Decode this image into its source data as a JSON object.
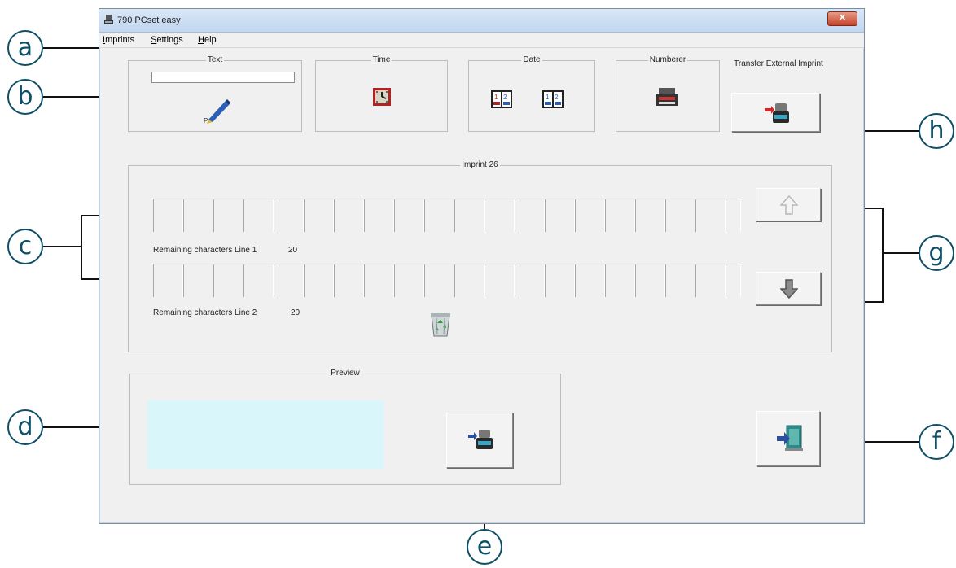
{
  "window": {
    "title": "790 PCset easy",
    "close_label": "✕"
  },
  "menu": [
    {
      "label": "Imprints"
    },
    {
      "label": "Settings"
    },
    {
      "label": "Help"
    }
  ],
  "groups": {
    "text": "Text",
    "time": "Time",
    "date": "Date",
    "numberer": "Numberer",
    "transfer": "Transfer External Imprint",
    "imprint": "Imprint 26",
    "preview": "Preview"
  },
  "text_input": {
    "value": ""
  },
  "lines": [
    {
      "label": "Remaining characters Line 1",
      "remaining": "20"
    },
    {
      "label": "Remaining characters Line 2",
      "remaining": "20"
    }
  ],
  "callouts": {
    "a": "a",
    "b": "b",
    "c": "c",
    "d": "d",
    "e": "e",
    "f": "f",
    "g": "g",
    "h": "h"
  },
  "icons": {
    "app": "stamp-icon",
    "text": "pen-icon",
    "time": "clock-icon",
    "date": "calendar-icon",
    "numberer": "numberer-icon",
    "transfer": "stamp-transfer-icon",
    "up": "arrow-up-icon",
    "down": "arrow-down-icon",
    "delete": "recycle-bin-icon",
    "exit": "exit-door-icon"
  },
  "colors": {
    "callout": "#0d4f66",
    "preview_bg": "#d9f6fb",
    "close_button": "#c5432a"
  }
}
